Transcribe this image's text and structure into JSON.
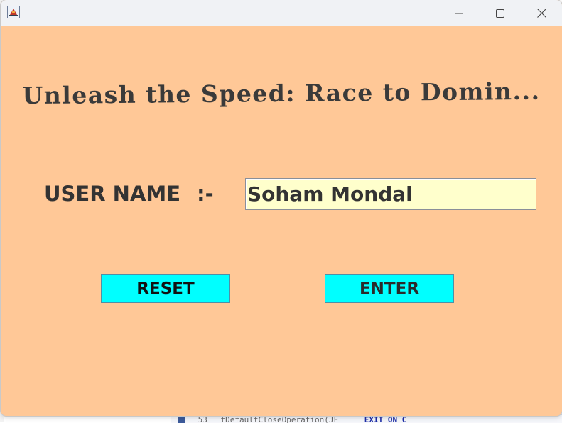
{
  "window": {
    "icon": "java-app-icon",
    "controls": [
      "minimize-icon",
      "maximize-icon",
      "close-icon"
    ]
  },
  "form": {
    "heading": "Unleash the Speed: Race to Domin...",
    "user_label": "USER NAME",
    "separator": ":-",
    "user_value": "Soham Mondal",
    "reset_label": "RESET",
    "enter_label": "ENTER"
  },
  "colors": {
    "background": "#ffc897",
    "input_background": "#ffffcc",
    "button_background": "#00ffff",
    "text": "#333333"
  },
  "background_editor": {
    "line_number": "53",
    "code_fragment": "tDefaultCloseOperation(JF",
    "code_highlight": "EXIT ON C"
  }
}
